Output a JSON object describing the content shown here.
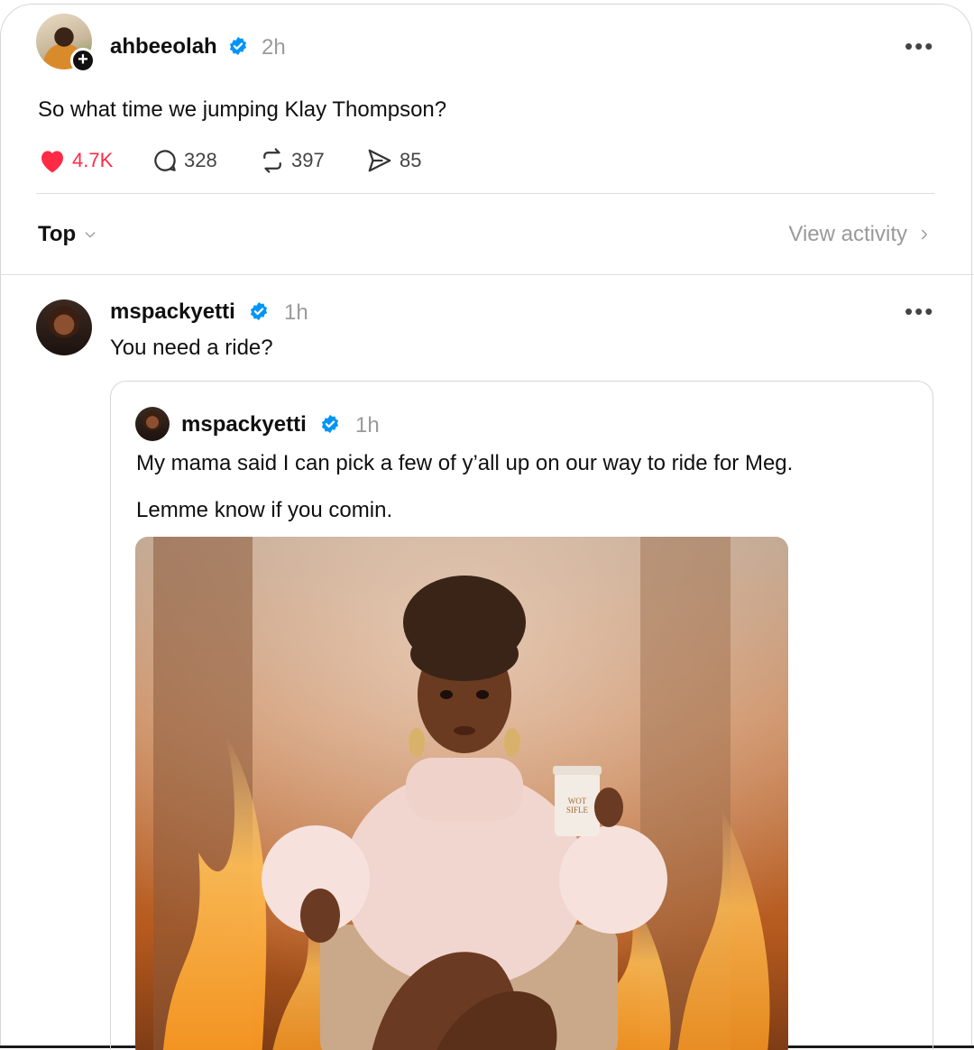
{
  "main_post": {
    "username": "ahbeeolah",
    "time": "2h",
    "text": "So what time we jumping Klay Thompson?",
    "likes": "4.7K",
    "comments": "328",
    "reposts": "397",
    "shares": "85"
  },
  "sort": {
    "label": "Top",
    "view_activity": "View activity"
  },
  "reply": {
    "username": "mspackyetti",
    "time": "1h",
    "text": "You need a ride?"
  },
  "quoted": {
    "username": "mspackyetti",
    "time": "1h",
    "line1": "My mama said I can pick a few of y’all up on our way to ride for Meg.",
    "line2": "Lemme know if you comin.",
    "cup_text": "WOT SIFLE"
  },
  "colors": {
    "like": "#ff2b45",
    "verified": "#0095f6",
    "muted": "#9a9a9a"
  },
  "icons": [
    "heart-icon",
    "comment-icon",
    "repost-icon",
    "share-icon",
    "more-icon",
    "verified-icon",
    "chevron-down-icon",
    "chevron-right-icon",
    "follow-plus-icon"
  ]
}
